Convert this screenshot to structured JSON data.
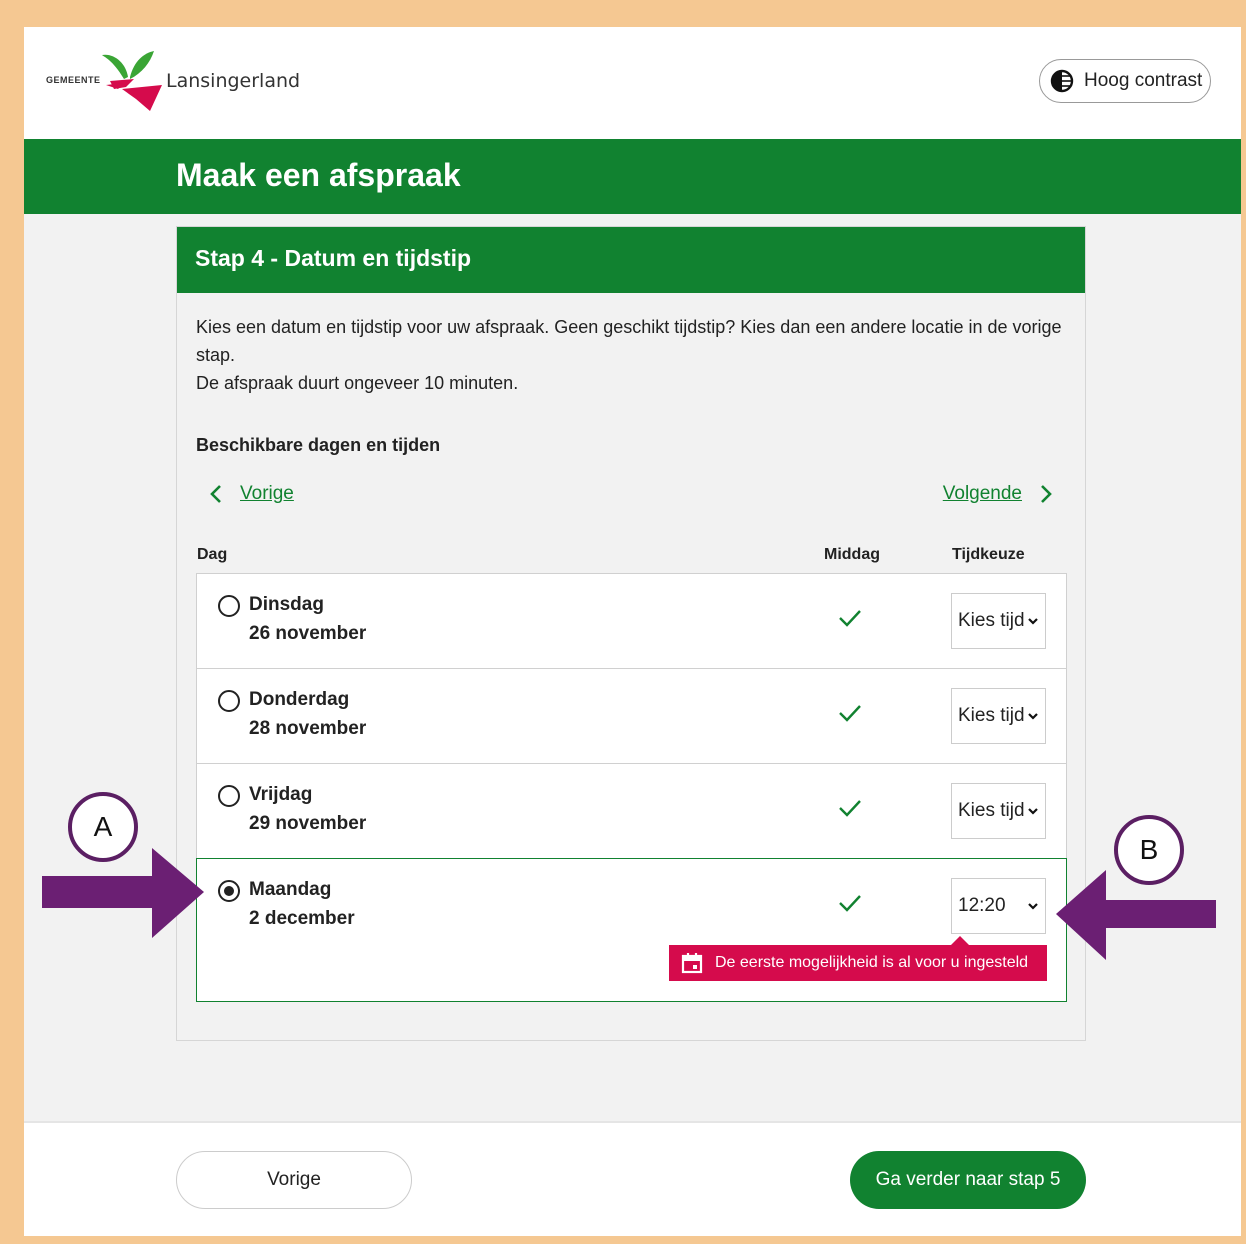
{
  "header": {
    "logo_small": "GEMEENTE",
    "logo_name": "Lansingerland",
    "contrast_label": "Hoog contrast"
  },
  "banner": {
    "title": "Maak een afspraak"
  },
  "step": {
    "title": "Stap 4 - Datum en tijdstip",
    "intro_line1": "Kies een datum en tijdstip voor uw afspraak. Geen geschikt tijdstip? Kies dan een andere locatie in de vorige stap.",
    "intro_line2": "De afspraak duurt ongeveer 10 minuten.",
    "available_heading": "Beschikbare dagen en tijden",
    "nav_prev": "Vorige",
    "nav_next": "Volgende",
    "columns": {
      "day": "Dag",
      "afternoon": "Middag",
      "time": "Tijdkeuze"
    },
    "rows": [
      {
        "day": "Dinsdag",
        "date": "26 november",
        "time": "Kies tijd",
        "selected": false
      },
      {
        "day": "Donderdag",
        "date": "28 november",
        "time": "Kies tijd",
        "selected": false
      },
      {
        "day": "Vrijdag",
        "date": "29 november",
        "time": "Kies tijd",
        "selected": false
      },
      {
        "day": "Maandag",
        "date": "2 december",
        "time": "12:20",
        "selected": true
      }
    ],
    "notice": "De eerste mogelijkheid is al voor u ingesteld"
  },
  "footer": {
    "prev_label": "Vorige",
    "next_label": "Ga verder naar stap 5"
  },
  "annotations": {
    "a": "A",
    "b": "B"
  },
  "colors": {
    "brand_green": "#118230",
    "notice_red": "#d50b4c",
    "annotation_purple": "#6b1f73"
  }
}
